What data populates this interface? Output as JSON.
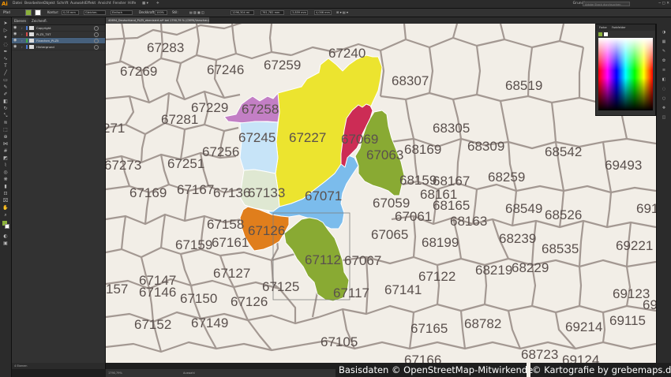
{
  "app": {
    "logo": "Ai"
  },
  "menubar": {
    "items": [
      "Datei",
      "Bearbeiten",
      "Objekt",
      "Schrift",
      "Auswahl",
      "Effekt",
      "Ansicht",
      "Fenster",
      "Hilfe"
    ],
    "workspace": "Grundlagen",
    "search_placeholder": "Adobe Stock durchsuchen"
  },
  "controlbar": {
    "mode_label": "Pfad",
    "stroke_label": "Kontur:",
    "stroke_value": "0,05 mm",
    "profile_label": "Gleichm.",
    "brush_label": "Einfach",
    "opacity_label": "Deckkraft:",
    "opacity_value": "100%",
    "style_label": "Stil:",
    "x_value": "1296,304 mi",
    "y_value": "781,782 mm",
    "w_value": "3,859 mm",
    "h_value": "4,006 mm",
    "fill_color": "#8bb13b"
  },
  "layers_panel": {
    "tabs": [
      "Ebenen",
      "Zeichenfl."
    ],
    "layers": [
      {
        "name": "Copyright",
        "color": "#4a7bd1",
        "selected": false
      },
      {
        "name": "PLZ5_TXT",
        "color": "#d14a4a",
        "selected": false
      },
      {
        "name": "Flaechen_PLZ5",
        "color": "#3fae3f",
        "selected": true
      },
      {
        "name": "Hintergrund",
        "color": "#4a7bd1",
        "selected": false
      }
    ],
    "footer": "4 Ebenen"
  },
  "document": {
    "tab_title": "40694_Deutschland_PLZ5_ebenisiert.ai* bei 1790,79 % (CMYK/Vorschau)"
  },
  "statusbar": {
    "zoom": "1790,79%",
    "tool": "Auswahl"
  },
  "color_panel": {
    "tabs": [
      "Farbe",
      "Farbfelder"
    ]
  },
  "map": {
    "region_colors": {
      "yellow": "#ece42f",
      "purple": "#c37fc5",
      "lightblue": "#c7e4f8",
      "green": "#dfe8d2",
      "blue": "#7bbcec",
      "crimson": "#cc2c55",
      "olive": "#89aa33",
      "orange": "#e07e1c"
    },
    "labels": [
      {
        "code": "67283"
      },
      {
        "code": "67240"
      },
      {
        "code": "67269"
      },
      {
        "code": "67246"
      },
      {
        "code": "67259"
      },
      {
        "code": "68307"
      },
      {
        "code": "68519"
      },
      {
        "code": "67229"
      },
      {
        "code": "67258"
      },
      {
        "code": "67281"
      },
      {
        "code": "271"
      },
      {
        "code": "68305"
      },
      {
        "code": "67245"
      },
      {
        "code": "67227"
      },
      {
        "code": "67069"
      },
      {
        "code": "67256"
      },
      {
        "code": "67063"
      },
      {
        "code": "68169"
      },
      {
        "code": "68309"
      },
      {
        "code": "68542"
      },
      {
        "code": "67273"
      },
      {
        "code": "67251"
      },
      {
        "code": "69493"
      },
      {
        "code": "68159"
      },
      {
        "code": "68167"
      },
      {
        "code": "68259"
      },
      {
        "code": "67169"
      },
      {
        "code": "67167"
      },
      {
        "code": "67136"
      },
      {
        "code": "67133"
      },
      {
        "code": "67071"
      },
      {
        "code": "68161"
      },
      {
        "code": "67059"
      },
      {
        "code": "68165"
      },
      {
        "code": "68549"
      },
      {
        "code": "68526"
      },
      {
        "code": "691"
      },
      {
        "code": "67061"
      },
      {
        "code": "68163"
      },
      {
        "code": "67158"
      },
      {
        "code": "67126"
      },
      {
        "code": "67065"
      },
      {
        "code": "68239"
      },
      {
        "code": "67159"
      },
      {
        "code": "67161"
      },
      {
        "code": "67112"
      },
      {
        "code": "68199"
      },
      {
        "code": "68535"
      },
      {
        "code": "69221"
      },
      {
        "code": "67067"
      },
      {
        "code": "67127"
      },
      {
        "code": "68219"
      },
      {
        "code": "68229"
      },
      {
        "code": "67147"
      },
      {
        "code": "67122"
      },
      {
        "code": "157"
      },
      {
        "code": "67146"
      },
      {
        "code": "67125"
      },
      {
        "code": "67141"
      },
      {
        "code": "69123"
      },
      {
        "code": "67150"
      },
      {
        "code": "67117"
      },
      {
        "code": "67126"
      },
      {
        "code": "69"
      },
      {
        "code": "67152"
      },
      {
        "code": "67149"
      },
      {
        "code": "67165"
      },
      {
        "code": "68782"
      },
      {
        "code": "69214"
      },
      {
        "code": "69115"
      },
      {
        "code": "67105"
      },
      {
        "code": "68723"
      },
      {
        "code": "67166"
      },
      {
        "code": "69124"
      }
    ]
  },
  "credits": {
    "left": "Basisdaten © OpenStreetMap-Mitwirkende",
    "right": "© Kartografie by grebemaps.de"
  }
}
